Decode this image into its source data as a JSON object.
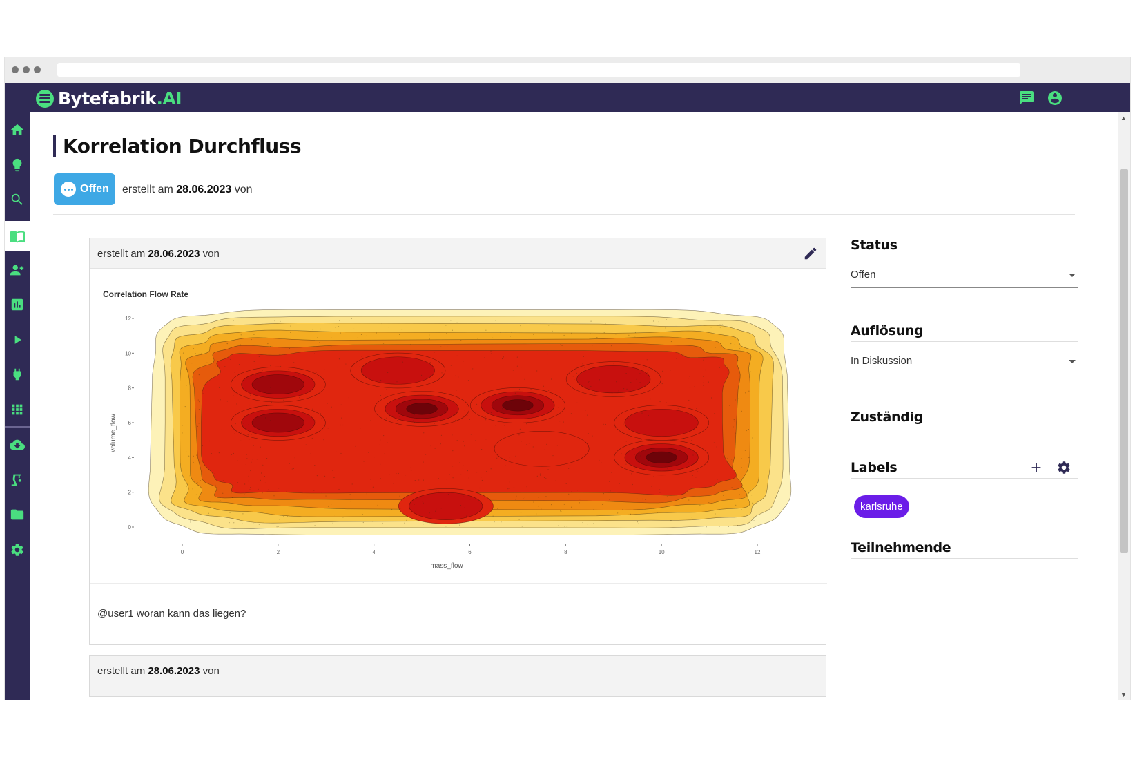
{
  "app": {
    "brand_main": "Bytefabrik",
    "brand_suffix": ".AI"
  },
  "sidebar": {
    "items": [
      {
        "icon": "home-icon"
      },
      {
        "icon": "lightbulb-icon"
      },
      {
        "icon": "search-icon"
      },
      {
        "icon": "book-icon",
        "active": true
      },
      {
        "icon": "users-icon"
      },
      {
        "icon": "bar-chart-icon"
      },
      {
        "icon": "play-icon"
      },
      {
        "icon": "plug-icon"
      },
      {
        "icon": "grid-icon"
      },
      {
        "icon": "cloud-download-icon"
      },
      {
        "icon": "crane-icon"
      },
      {
        "icon": "folder-icon"
      },
      {
        "icon": "gear-icon"
      }
    ]
  },
  "page": {
    "title": "Korrelation Durchfluss",
    "status_badge": "Offen",
    "meta_prefix": "erstellt am",
    "meta_date": "28.06.2023",
    "meta_suffix": "von"
  },
  "post": {
    "meta_prefix": "erstellt am",
    "meta_date": "28.06.2023",
    "meta_suffix": "von",
    "comment": "@user1 woran kann das liegen?"
  },
  "post2": {
    "meta_prefix": "erstellt am",
    "meta_date": "28.06.2023",
    "meta_suffix": "von"
  },
  "panel": {
    "status_label": "Status",
    "status_value": "Offen",
    "resolution_label": "Auflösung",
    "resolution_value": "In Diskussion",
    "assignee_label": "Zuständig",
    "labels_label": "Labels",
    "label_chip": "karlsruhe",
    "participants_label": "Teilnehmende"
  },
  "colors": {
    "navy": "#2f2a55",
    "green": "#4ade80",
    "status_blue": "#3ea8e5",
    "chip_purple": "#6b1de8"
  },
  "chart_data": {
    "type": "heatmap",
    "title": "Correlation Flow Rate",
    "xlabel": "mass_flow",
    "ylabel": "volume_flow",
    "xlim": [
      0,
      12
    ],
    "ylim": [
      0,
      12
    ],
    "x_ticks": [
      "0",
      "2",
      "4",
      "6",
      "8",
      "10",
      "12"
    ],
    "y_ticks": [
      "0",
      "2",
      "4",
      "6",
      "8",
      "10",
      "12"
    ],
    "palette": [
      "#fdf2b8",
      "#fbe28a",
      "#f8c94a",
      "#f4ad22",
      "#ef8a12",
      "#e65b0c",
      "#e0260f",
      "#c8100e",
      "#a0070c",
      "#6d0309"
    ],
    "density_peaks": [
      {
        "x": 2.0,
        "y": 8.2,
        "level": 0.9
      },
      {
        "x": 2.0,
        "y": 6.0,
        "level": 0.85
      },
      {
        "x": 5.0,
        "y": 6.8,
        "level": 0.95
      },
      {
        "x": 7.0,
        "y": 7.0,
        "level": 1.0
      },
      {
        "x": 10.0,
        "y": 4.0,
        "level": 0.95
      },
      {
        "x": 10.0,
        "y": 6.0,
        "level": 0.8
      },
      {
        "x": 5.5,
        "y": 1.2,
        "level": 0.8
      },
      {
        "x": 4.5,
        "y": 9.0,
        "level": 0.75
      },
      {
        "x": 9.0,
        "y": 8.5,
        "level": 0.75
      },
      {
        "x": 7.5,
        "y": 4.5,
        "level": 0.7
      }
    ]
  }
}
